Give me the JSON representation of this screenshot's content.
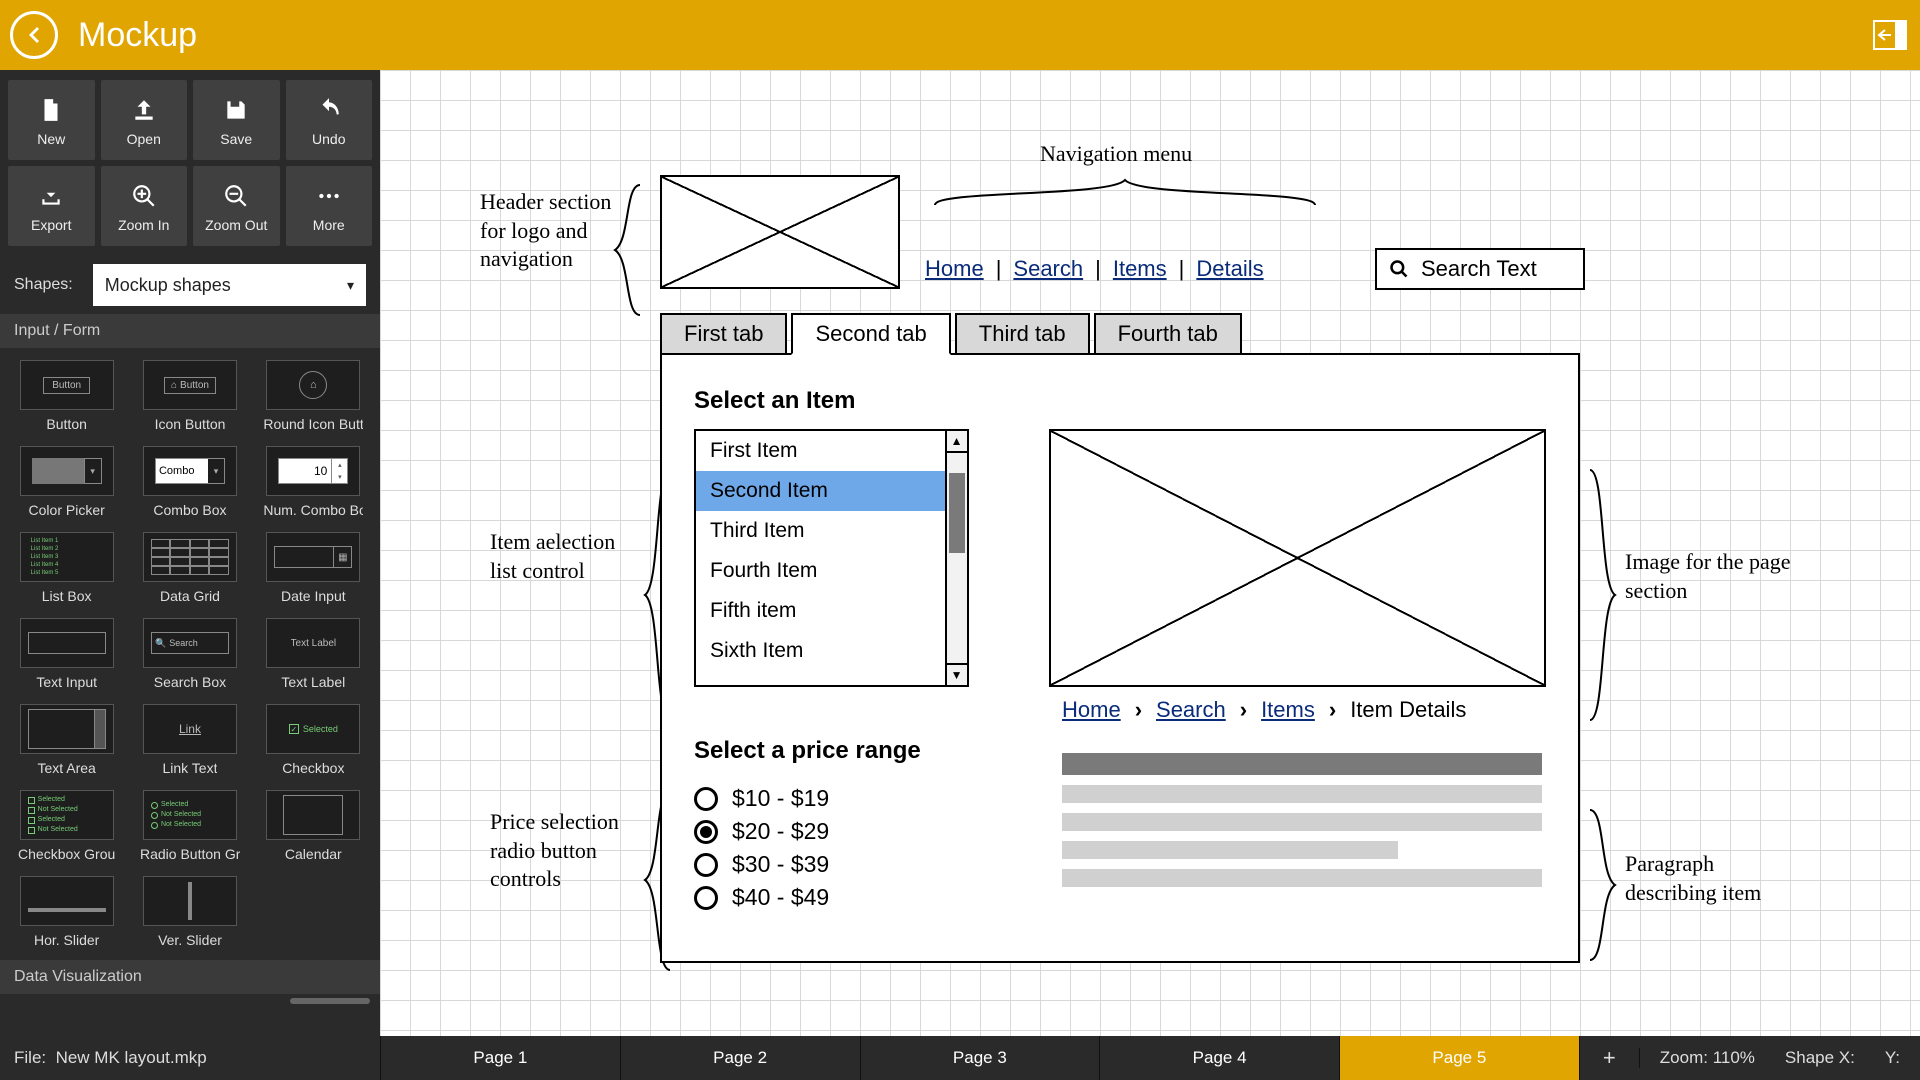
{
  "app": {
    "title": "Mockup"
  },
  "toolbar": [
    {
      "id": "new",
      "label": "New"
    },
    {
      "id": "open",
      "label": "Open"
    },
    {
      "id": "save",
      "label": "Save"
    },
    {
      "id": "undo",
      "label": "Undo"
    },
    {
      "id": "export",
      "label": "Export"
    },
    {
      "id": "zoomin",
      "label": "Zoom In"
    },
    {
      "id": "zoomout",
      "label": "Zoom Out"
    },
    {
      "id": "more",
      "label": "More"
    }
  ],
  "shapes_label": "Shapes:",
  "shapes_dropdown": "Mockup shapes",
  "sections": {
    "input_form": "Input / Form",
    "data_viz": "Data Visualization"
  },
  "shape_items": [
    "Button",
    "Icon Button",
    "Round Icon Butt",
    "Color Picker",
    "Combo Box",
    "Num. Combo Bo",
    "List Box",
    "Data Grid",
    "Date Input",
    "Text Input",
    "Search Box",
    "Text Label",
    "Text Area",
    "Link Text",
    "Checkbox",
    "Checkbox Grou",
    "Radio Button Gr",
    "Calendar",
    "Hor. Slider",
    "Ver. Slider"
  ],
  "thumb_text": {
    "button": "Button",
    "icon_button": "Button",
    "combo": "Combo",
    "num": "10",
    "search": "Search",
    "label": "Text Label",
    "link": "Link",
    "checkbox": "Selected",
    "group": [
      "Selected",
      "Not Selected",
      "Selected",
      "Not Selected"
    ],
    "radio_group": [
      "Selected",
      "Not Selected",
      "Not Selected"
    ],
    "list": [
      "List Item 1",
      "List Item 2",
      "List Item 3",
      "List Item 4",
      "List Item 5"
    ]
  },
  "canvas": {
    "annot_header": "Header section for logo and navigation",
    "annot_nav": "Navigation menu",
    "annot_itemlist": "Item aelection list control",
    "annot_price": "Price selection radio button controls",
    "annot_image": "Image for the page section",
    "annot_para": "Paragraph describing item",
    "nav_links": [
      "Home",
      "Search",
      "Items",
      "Details"
    ],
    "search_placeholder": "Search Text",
    "tabs": [
      "First tab",
      "Second tab",
      "Third tab",
      "Fourth tab"
    ],
    "active_tab": 1,
    "list_title": "Select an Item",
    "list_items": [
      "First Item",
      "Second Item",
      "Third Item",
      "Fourth Item",
      "Fifth item",
      "Sixth Item"
    ],
    "list_selected": 1,
    "price_title": "Select a price range",
    "prices": [
      "$10 - $19",
      "$20 - $29",
      "$30 - $39",
      "$40 - $49"
    ],
    "price_selected": 1,
    "crumbs": [
      "Home",
      "Search",
      "Items",
      "Item Details"
    ]
  },
  "status": {
    "file_label": "File:",
    "file_name": "New MK layout.mkp",
    "pages": [
      "Page 1",
      "Page 2",
      "Page 3",
      "Page 4",
      "Page 5"
    ],
    "active_page": 4,
    "zoom_label": "Zoom:",
    "zoom_value": "110%",
    "shapex": "Shape X:",
    "shapey": "Y:"
  }
}
